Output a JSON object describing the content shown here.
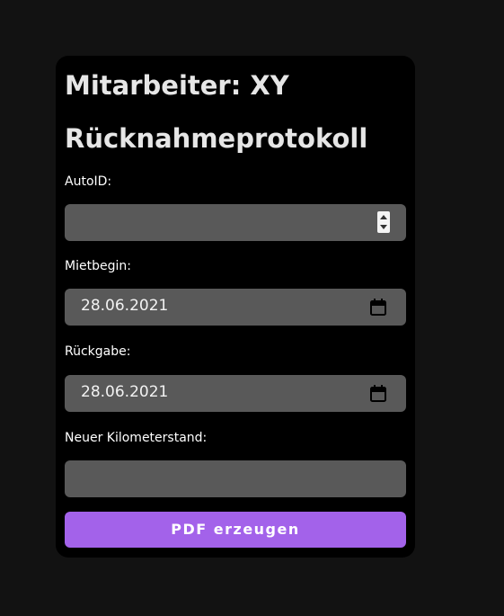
{
  "header": {
    "title": "Mitarbeiter: XY",
    "subtitle": "Rücknahmeprotokoll"
  },
  "form": {
    "autoid": {
      "label": "AutoID:",
      "value": ""
    },
    "mietbeginn": {
      "label": "Mietbegin:",
      "value": "28.06.2021"
    },
    "rueckgabe": {
      "label": "Rückgabe:",
      "value": "28.06.2021"
    },
    "kilometerstand": {
      "label": "Neuer Kilometerstand:",
      "value": ""
    },
    "submit_label": "PDF erzeugen"
  },
  "colors": {
    "page_background": "#121212",
    "card_background": "#000000",
    "field_background": "#595959",
    "accent": "#a362ea"
  },
  "icons": {
    "autoid_field": "number-spinner-icon",
    "date_fields": "calendar-icon"
  }
}
